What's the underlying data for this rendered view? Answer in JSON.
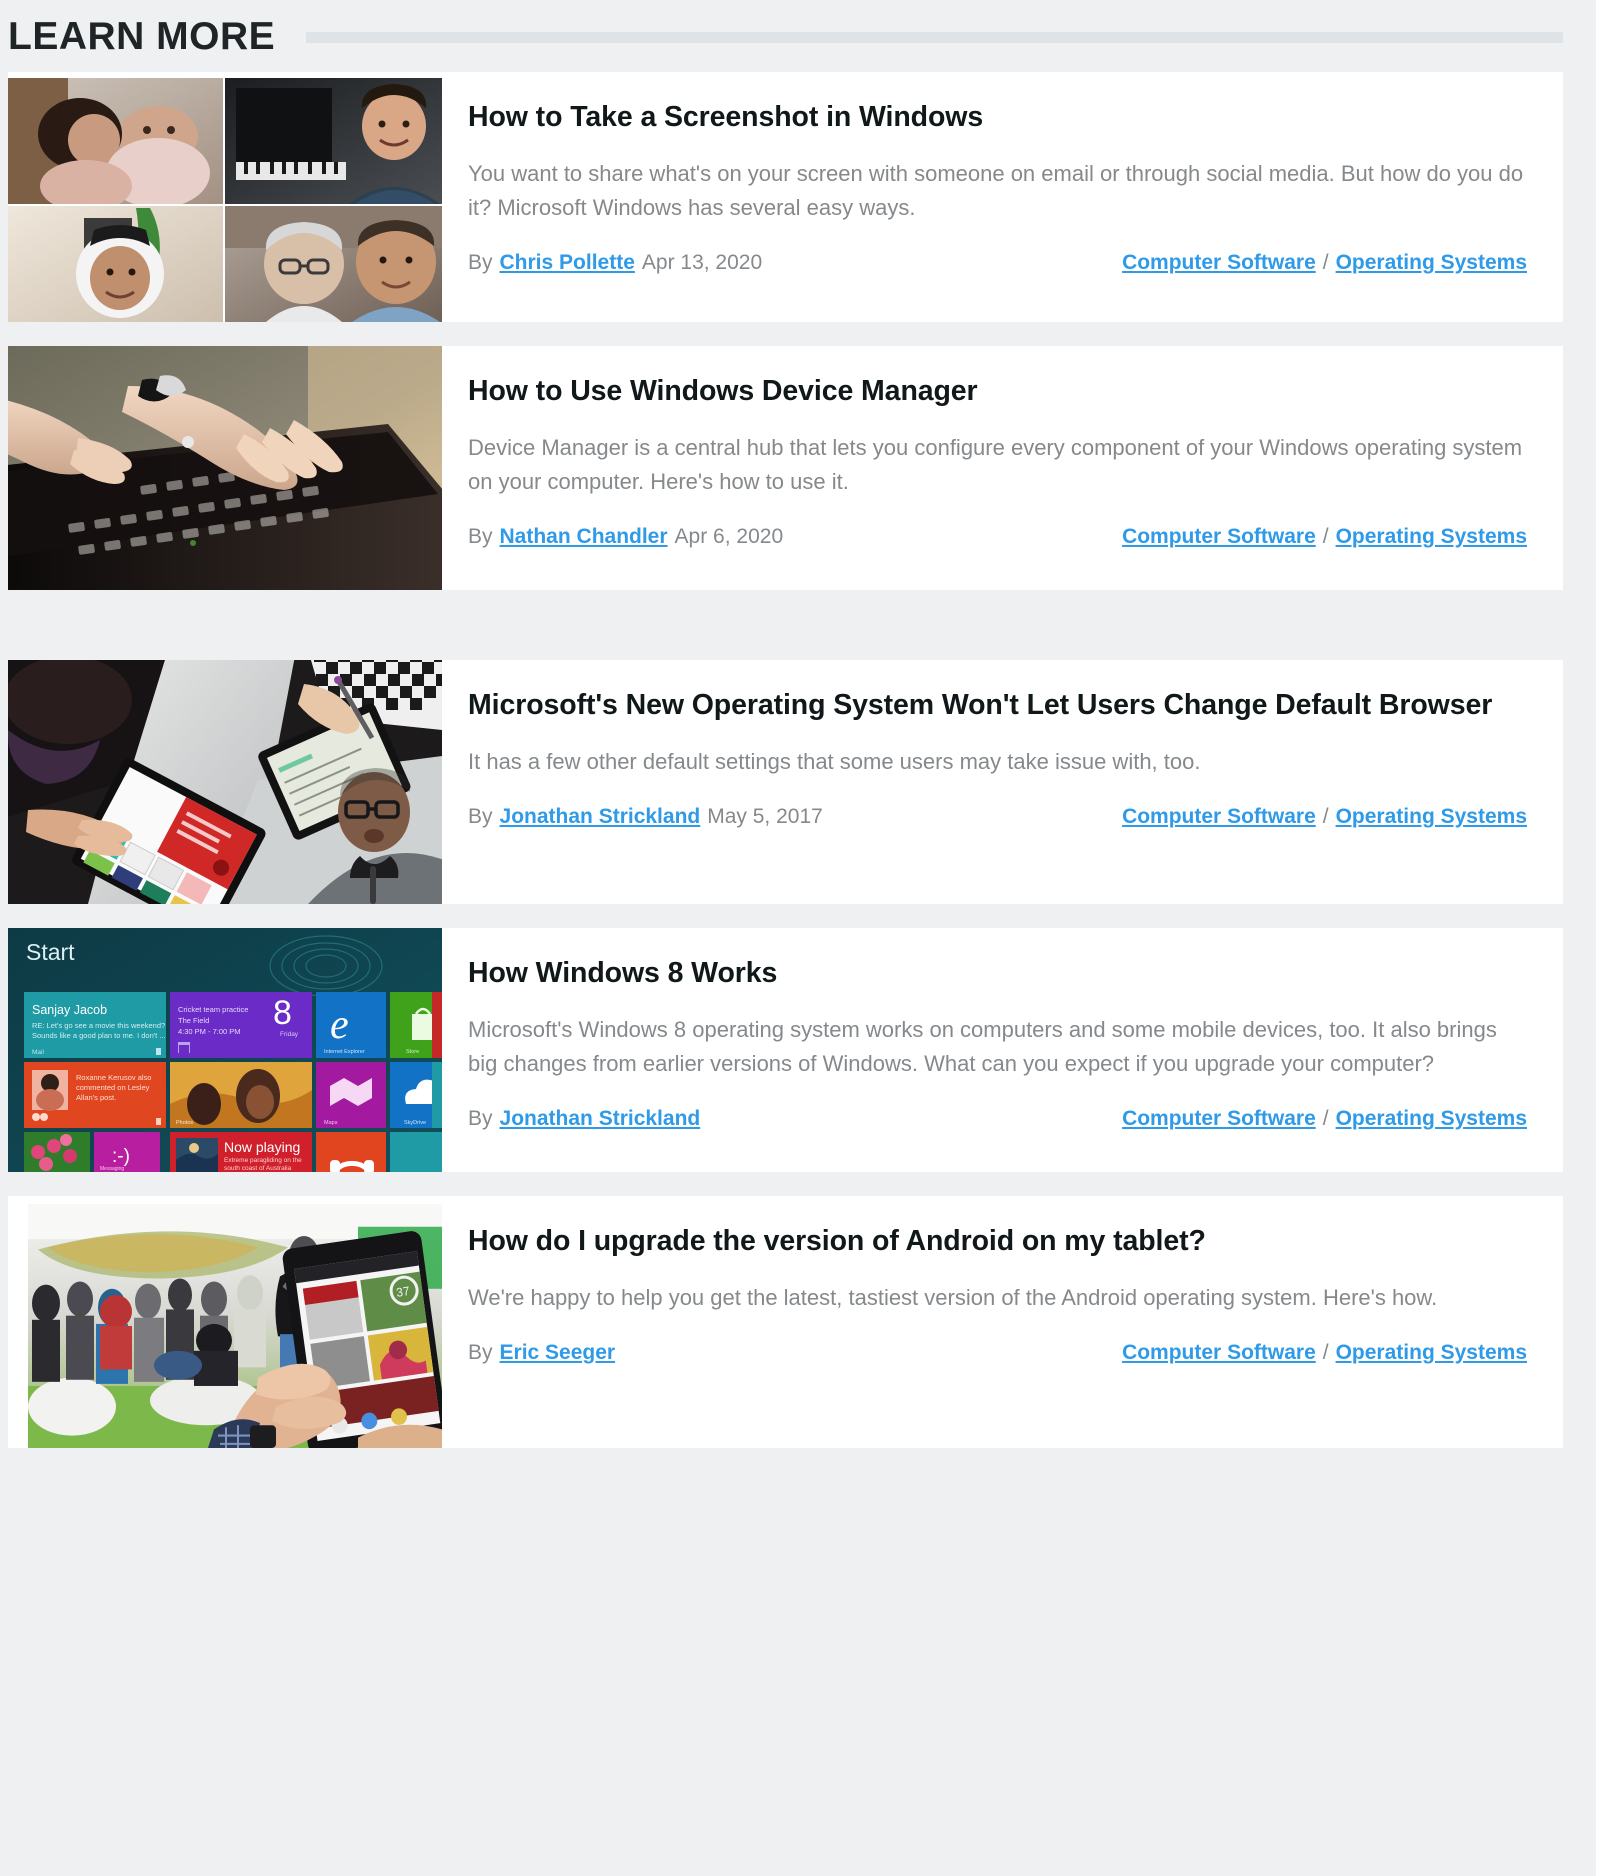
{
  "section": {
    "title": "LEARN MORE",
    "rule_color": "#dde3e6"
  },
  "theme": {
    "page_background": "#eef0f1",
    "card_background": "#ffffff",
    "link_color": "#2f9ae8",
    "title_color": "#11181a",
    "muted_text_color": "#85898c"
  },
  "labels": {
    "by": "By",
    "separator": "/"
  },
  "articles": [
    {
      "title": "How to Take a Screenshot in Windows",
      "description": "You want to share what's on your screen with someone on email or through social media. But how do you do it? Microsoft Windows has several easy ways.",
      "author": "Chris Pollette",
      "date": "Apr 13, 2020",
      "category_primary": "Computer Software",
      "category_secondary": "Operating Systems",
      "thumbnail_name": "video-call-grid-thumbnail"
    },
    {
      "title": "How to Use Windows Device Manager",
      "description": "Device Manager is a central hub that lets you configure every component of your Windows operating system on your computer. Here's how to use it.",
      "author": "Nathan Chandler",
      "date": "Apr 6, 2020",
      "category_primary": "Computer Software",
      "category_secondary": "Operating Systems",
      "thumbnail_name": "hands-typing-laptop-thumbnail"
    },
    {
      "title": "Microsoft's New Operating System Won't Let Users Change Default Browser",
      "description": "It has a few other default settings that some users may take issue with, too.",
      "author": "Jonathan Strickland",
      "date": "May 5, 2017",
      "category_primary": "Computer Software",
      "category_secondary": "Operating Systems",
      "thumbnail_name": "tablets-meeting-speaker-thumbnail"
    },
    {
      "title": "How Windows 8 Works",
      "description": "Microsoft's Windows 8 operating system works on computers and some mobile devices, too. It also brings big changes from earlier versions of Windows. What can you expect if you upgrade your computer?",
      "author": "Jonathan Strickland",
      "date": "",
      "category_primary": "Computer Software",
      "category_secondary": "Operating Systems",
      "thumbnail_name": "windows-8-start-screen-thumbnail",
      "thumbnail_text": {
        "start": "Start",
        "tile_mail_name": "Sanjay Jacob",
        "tile_mail_line1": "RE: Let's go see a movie this weekend?",
        "tile_mail_line2": "Sounds like a good plan to me. I don't ...",
        "tile_mail_label": "Mail",
        "tile_cal_line1": "Cricket team practice",
        "tile_cal_line2": "The Field",
        "tile_cal_line3": "4:30 PM - 7:00 PM",
        "tile_cal_day": "8",
        "tile_cal_weekday": "Friday",
        "tile_ie_label": "Internet Explorer",
        "tile_store_label": "Store",
        "tile_people_text": "Roxanne Kerusov also commented on Lesley Allan's post.",
        "tile_photos_label": "Photos",
        "tile_maps_label": "Maps",
        "tile_skydrive_label": "SkyDrive",
        "tile_music_title": "Now playing",
        "tile_music_sub": "Extreme paragliding on the south coast of Australia",
        "tile_messaging_label": "Messaging"
      }
    },
    {
      "title": "How do I upgrade the version of Android on my tablet?",
      "description": "We're happy to help you get the latest, tastiest version of the Android operating system. Here's how.",
      "author": "Eric Seeger",
      "date": "",
      "category_primary": "Computer Software",
      "category_secondary": "Operating Systems",
      "thumbnail_name": "hands-holding-tablet-event-thumbnail"
    }
  ]
}
